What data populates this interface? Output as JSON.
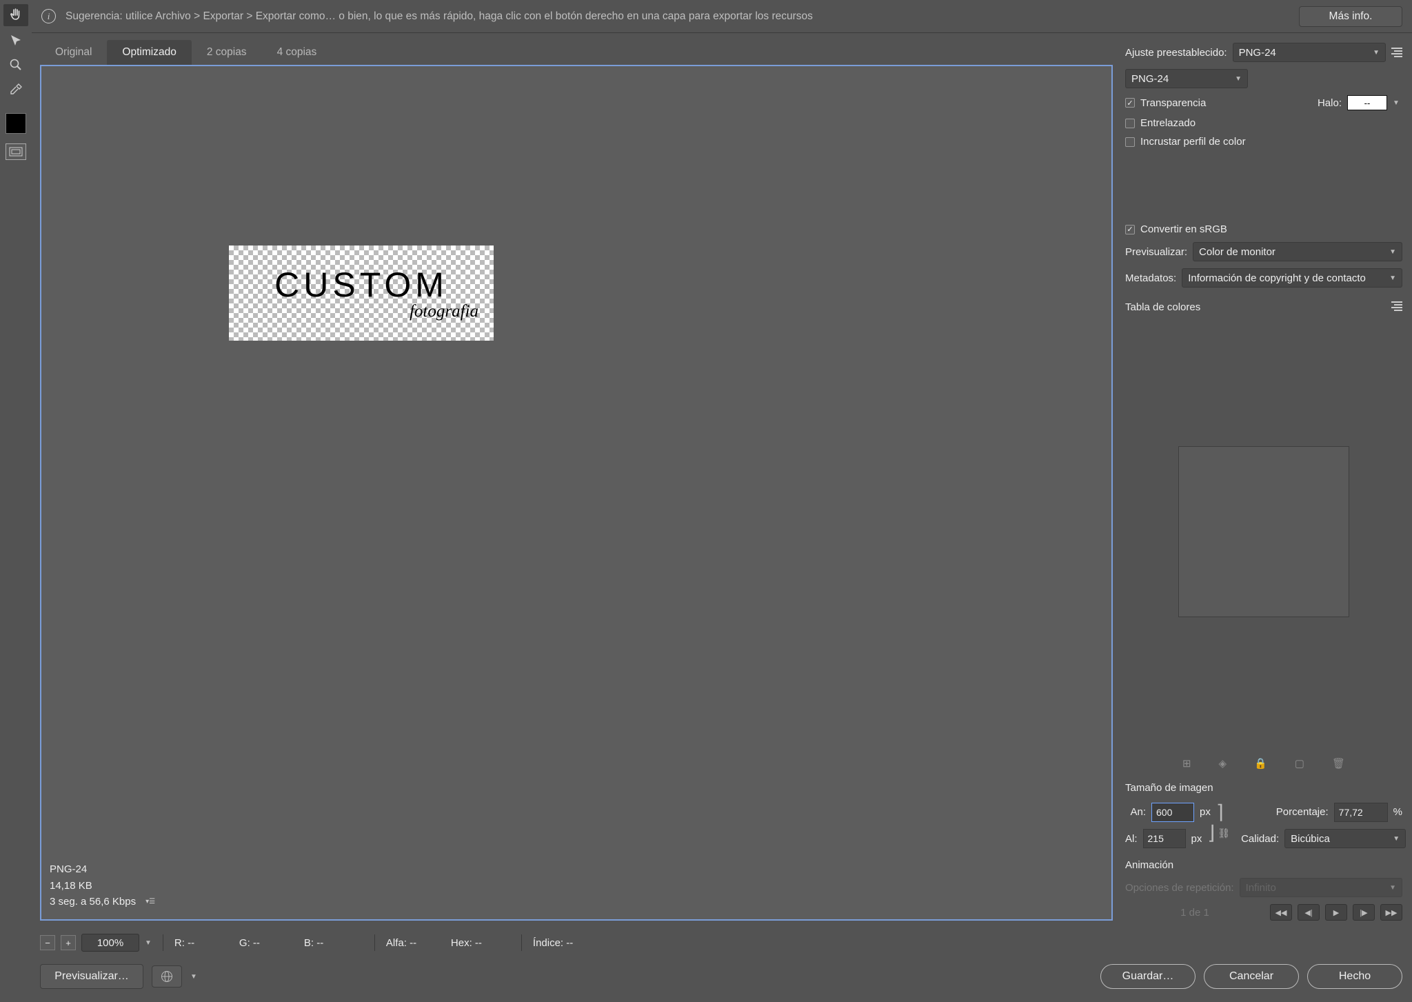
{
  "hint": {
    "text": "Sugerencia: utilice Archivo > Exportar > Exportar como… o bien, lo que es más rápido, haga clic con el botón derecho en una capa para exportar los recursos",
    "more_info": "Más info."
  },
  "tabs": {
    "t0": "Original",
    "t1": "Optimizado",
    "t2": "2 copias",
    "t3": "4 copias"
  },
  "artboard": {
    "line1": "CUSTOM",
    "line2": "fotografia"
  },
  "canvas_info": {
    "format": "PNG-24",
    "size": "14,18 KB",
    "time": "3 seg. a 56,6 Kbps"
  },
  "settings": {
    "preset_label": "Ajuste preestablecido:",
    "preset_value": "PNG-24",
    "format_value": "PNG-24",
    "transparency": "Transparencia",
    "halo_label": "Halo:",
    "halo_value": "--",
    "interlaced": "Entrelazado",
    "embed_profile": "Incrustar perfil de color",
    "convert_srgb": "Convertir en sRGB",
    "preview_label": "Previsualizar:",
    "preview_value": "Color de monitor",
    "metadata_label": "Metadatos:",
    "metadata_value": "Información de copyright y de contacto",
    "color_table_label": "Tabla de colores"
  },
  "image_size": {
    "header": "Tamaño de imagen",
    "w_label": "An:",
    "w_value": "600",
    "h_label": "Al:",
    "h_value": "215",
    "px": "px",
    "percent_label": "Porcentaje:",
    "percent_value": "77,72",
    "percent_suffix": "%",
    "quality_label": "Calidad:",
    "quality_value": "Bicúbica"
  },
  "animation": {
    "header": "Animación",
    "repeat_label": "Opciones de repetición:",
    "repeat_value": "Infinito",
    "counter": "1 de 1"
  },
  "status": {
    "zoom": "100%",
    "r": "R: --",
    "g": "G: --",
    "b": "B: --",
    "alpha": "Alfa: --",
    "hex": "Hex: --",
    "index": "Índice: --"
  },
  "buttons": {
    "preview": "Previsualizar…",
    "save": "Guardar…",
    "cancel": "Cancelar",
    "done": "Hecho"
  }
}
